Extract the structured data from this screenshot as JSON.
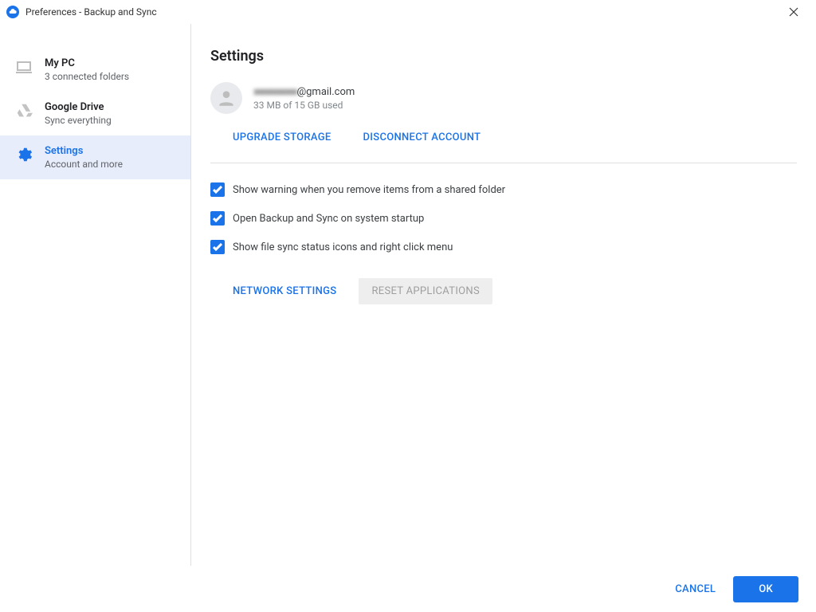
{
  "window": {
    "title": "Preferences - Backup and Sync"
  },
  "sidebar": {
    "items": [
      {
        "title": "My PC",
        "subtitle": "3 connected folders"
      },
      {
        "title": "Google Drive",
        "subtitle": "Sync everything"
      },
      {
        "title": "Settings",
        "subtitle": "Account and more"
      }
    ]
  },
  "main": {
    "heading": "Settings",
    "account": {
      "email_obscured": "xxxxxxxxxxx",
      "email_suffix": "@gmail.com",
      "usage": "33 MB of 15 GB used"
    },
    "links": {
      "upgrade": "UPGRADE STORAGE",
      "disconnect": "DISCONNECT ACCOUNT"
    },
    "checks": [
      {
        "label": "Show warning when you remove items from a shared folder",
        "checked": true
      },
      {
        "label": "Open Backup and Sync on system startup",
        "checked": true
      },
      {
        "label": "Show file sync status icons and right click menu",
        "checked": true
      }
    ],
    "buttons": {
      "network": "NETWORK SETTINGS",
      "reset": "RESET APPLICATIONS"
    }
  },
  "footer": {
    "cancel": "CANCEL",
    "ok": "OK"
  }
}
